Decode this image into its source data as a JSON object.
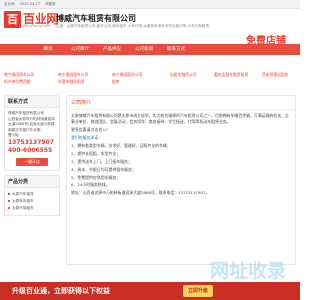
{
  "topbar": {
    "site": "百业网",
    "date": "2025-04-17",
    "action": "请登录"
  },
  "header": {
    "logo_char": "百",
    "logo_text": "百业网",
    "logo_domain": "baiyewang.com",
    "company_name": "博威汽车租赁有限公司",
    "company_desc": "主营：太原汽车租赁公司,租车公司,商务租车,小车代驾,太原商务用车专车出租代驾,小车代驾租赁.",
    "free_shop": "免费店铺"
  },
  "nav": [
    "网页",
    "公司简介",
    "产品供应",
    "公司新闻",
    "联系方式"
  ],
  "crumbs": [
    "南宁贵园租车公司",
    "南宁贵园租车公司",
    "南宁贵园租车公司",
    "出租车融资公司",
    "重庆出租车融资租赁",
    "西安贸营出租车",
    "机关单位费用租",
    "东营市融资租赁",
    "租房"
  ],
  "contact": {
    "title": "联系方式",
    "company": "博威汽车租赁有限公司",
    "address": "山西省太原市万柏林街道迎泽大道2888号(迎泽大道与新建南路交叉路口东北角)",
    "person": "曹小姐",
    "phone": "13753137907",
    "hotline": "400-6006555",
    "button": "一键开店"
  },
  "products": {
    "title": "产品分类",
    "items": [
      "太原汽车租赁",
      "太原商务租车",
      "太原代驾租车"
    ]
  },
  "main": {
    "title": "公司简介",
    "paragraphs": [
      "太原博威汽车租赁有限公司是太原市成立较早，实力较为雄厚的汽车租赁公司之一，目前拥有车辆百余辆，可满足政府机关、企事业单位、旅游团队、会展活动、会务用车、商务接待、学生接送、代驾等机动车租赁业务。",
      "更多优惠请点击进入！"
    ],
    "advantage_title": "我们的服务承诺：",
    "list": [
      "1、拥有各类型车辆，技术好、管理好、证照齐全的车辆；",
      "2、提供长短租，车型齐全；",
      "3、提供送车上门，上门接车服务；",
      "4、周末、节假日均可提供租车服务；",
      "5、免费提供应急用车服务；",
      "6、24小时服务热线。"
    ],
    "footer_line": "地址：山西省太原市万柏林街道迎泽大道2888号，联系电话：13753137907。"
  },
  "footer": {
    "text": "升级百业通，立即获得以下权益",
    "button": "立即升级"
  },
  "watermark": "网址收录"
}
